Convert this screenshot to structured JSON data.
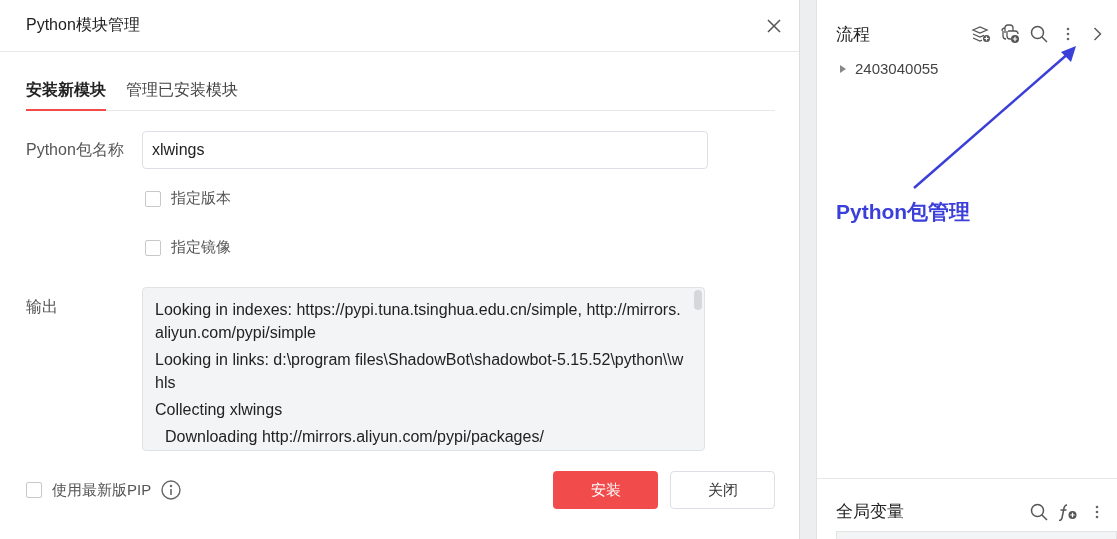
{
  "dialog": {
    "title": "Python模块管理",
    "tabs": [
      {
        "label": "安装新模块",
        "selected": true
      },
      {
        "label": "管理已安装模块",
        "selected": false
      }
    ],
    "package_field": {
      "label": "Python包名称",
      "value": "xlwings"
    },
    "options": [
      {
        "label": "指定版本",
        "checked": false
      },
      {
        "label": "指定镜像",
        "checked": false
      }
    ],
    "output": {
      "label": "输出",
      "lines": [
        {
          "text": "Looking in indexes: https://pypi.tuna.tsinghua.edu.cn/simple, http://mirrors.aliyun.com/pypi/simple",
          "indented": false
        },
        {
          "text": "Looking in links: d:\\program files\\ShadowBot\\shadowbot-5.15.52\\python\\\\whls",
          "indented": false
        },
        {
          "text": "Collecting xlwings",
          "indented": false
        },
        {
          "text": "Downloading http://mirrors.aliyun.com/pypi/packages/",
          "indented": true
        }
      ]
    },
    "footer_option": {
      "label": "使用最新版PIP",
      "checked": false
    },
    "buttons": [
      {
        "label": "安装",
        "kind": "primary"
      },
      {
        "label": "关闭",
        "kind": "default"
      }
    ]
  },
  "flow_panel": {
    "title": "流程",
    "items": [
      {
        "label": "2403040055",
        "expanded": false
      }
    ]
  },
  "variables_panel": {
    "title": "全局变量"
  },
  "annotation": {
    "text": "Python包管理"
  }
}
